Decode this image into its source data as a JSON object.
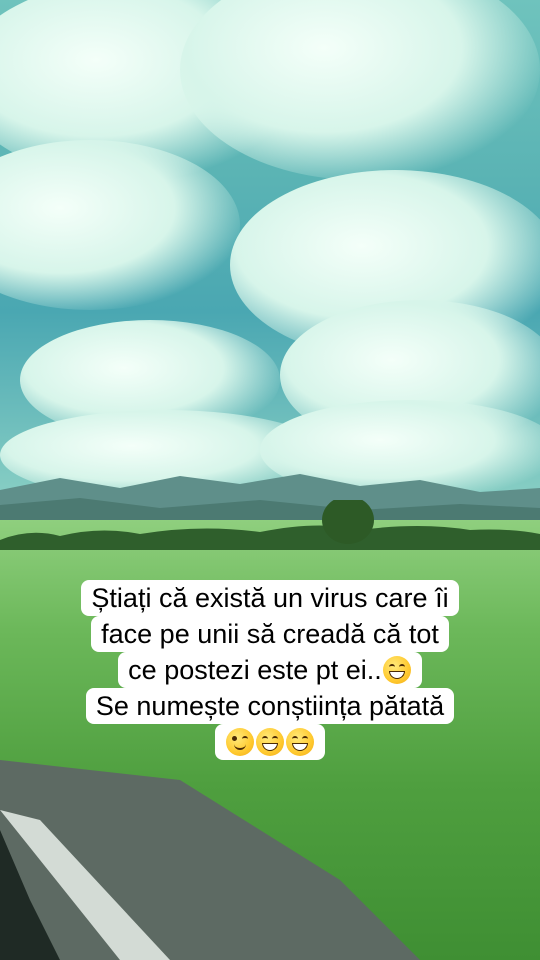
{
  "caption": {
    "line1": "Știați că există un virus care îi",
    "line2": "face pe unii să creadă că tot",
    "line3": "ce postezi este pt ei..",
    "line4": "Se numește conștiința pătată"
  },
  "emojis": {
    "line3": [
      "grinning-face"
    ],
    "line5": [
      "winking-face",
      "grinning-face",
      "grinning-face"
    ]
  },
  "colors": {
    "caption_background": "#ffffff",
    "caption_text": "#000000"
  }
}
